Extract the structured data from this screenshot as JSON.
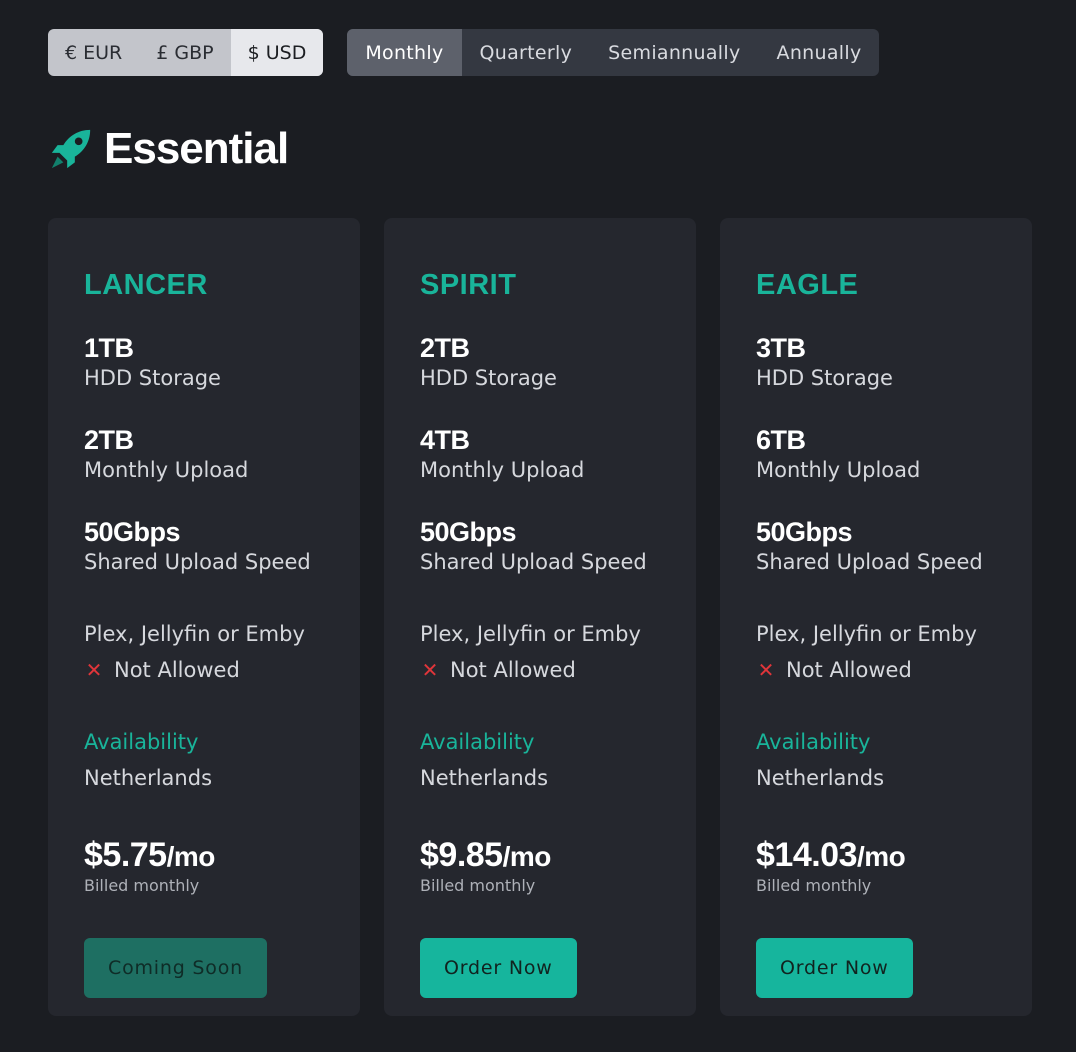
{
  "currency": {
    "options": [
      "€ EUR",
      "£ GBP",
      "$ USD"
    ],
    "selected": "$ USD"
  },
  "period": {
    "options": [
      "Monthly",
      "Quarterly",
      "Semiannually",
      "Annually"
    ],
    "selected": "Monthly"
  },
  "section": {
    "title": "Essential",
    "icon": "rocket-icon"
  },
  "colors": {
    "accent": "#19b49a",
    "background": "#1b1d22",
    "card": "#25272e",
    "danger": "#e0353a"
  },
  "plans": [
    {
      "name": "LANCER",
      "storage": {
        "value": "1TB",
        "desc": "HDD Storage"
      },
      "upload": {
        "value": "2TB",
        "desc": "Monthly Upload"
      },
      "speed": {
        "value": "50Gbps",
        "desc": "Shared Upload Speed"
      },
      "media_label": "Plex, Jellyfin or Emby",
      "media_status": "Not Allowed",
      "availability_label": "Availability",
      "availability": "Netherlands",
      "price": "$5.75",
      "per": "/mo",
      "billed": "Billed monthly",
      "button": "Coming Soon",
      "button_disabled": true
    },
    {
      "name": "SPIRIT",
      "storage": {
        "value": "2TB",
        "desc": "HDD Storage"
      },
      "upload": {
        "value": "4TB",
        "desc": "Monthly Upload"
      },
      "speed": {
        "value": "50Gbps",
        "desc": "Shared Upload Speed"
      },
      "media_label": "Plex, Jellyfin or Emby",
      "media_status": "Not Allowed",
      "availability_label": "Availability",
      "availability": "Netherlands",
      "price": "$9.85",
      "per": "/mo",
      "billed": "Billed monthly",
      "button": "Order Now",
      "button_disabled": false
    },
    {
      "name": "EAGLE",
      "storage": {
        "value": "3TB",
        "desc": "HDD Storage"
      },
      "upload": {
        "value": "6TB",
        "desc": "Monthly Upload"
      },
      "speed": {
        "value": "50Gbps",
        "desc": "Shared Upload Speed"
      },
      "media_label": "Plex, Jellyfin or Emby",
      "media_status": "Not Allowed",
      "availability_label": "Availability",
      "availability": "Netherlands",
      "price": "$14.03",
      "per": "/mo",
      "billed": "Billed monthly",
      "button": "Order Now",
      "button_disabled": false
    }
  ]
}
